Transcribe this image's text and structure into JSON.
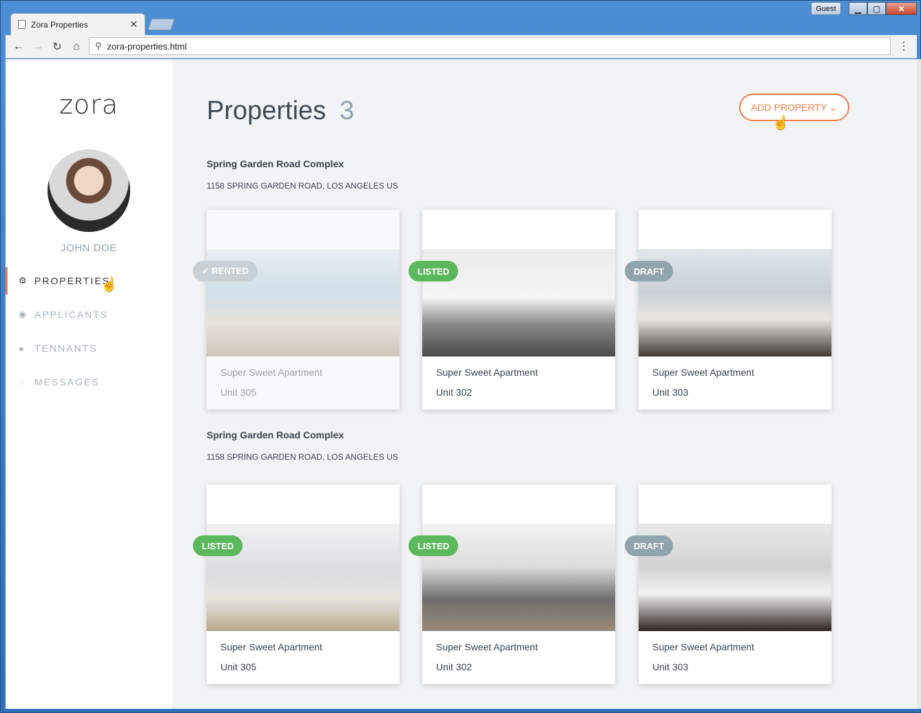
{
  "browser": {
    "tab_title": "Zora Properties",
    "guest_label": "Guest",
    "url": "zora-properties.html"
  },
  "sidebar": {
    "logo": "zora",
    "user_name": "JOHN DOE",
    "items": [
      {
        "label": "PROPERTIES",
        "icon": "gears-icon"
      },
      {
        "label": "APPLICANTS",
        "icon": "user-circle-icon"
      },
      {
        "label": "TENNANTS",
        "icon": "users-icon"
      },
      {
        "label": "MESSAGES",
        "icon": "chat-icon"
      }
    ]
  },
  "header": {
    "title": "Properties",
    "count": "3",
    "add_button": "ADD PROPERTY ⌄"
  },
  "groups": [
    {
      "title": "Spring Garden Road Complex",
      "address": "1158 SPRING GARDEN ROAD, LOS ANGELES US",
      "cards": [
        {
          "name": "Super Sweet Apartment",
          "unit": "Unit 305",
          "status": "✓ RENTED"
        },
        {
          "name": "Super Sweet Apartment",
          "unit": "Unit 302",
          "status": "LISTED"
        },
        {
          "name": "Super Sweet Apartment",
          "unit": "Unit 303",
          "status": "DRAFT"
        }
      ]
    },
    {
      "title": "Spring Garden Road Complex",
      "address": "1158 SPRING GARDEN ROAD, LOS ANGELES US",
      "cards": [
        {
          "name": "Super Sweet Apartment",
          "unit": "Unit 305",
          "status": "LISTED"
        },
        {
          "name": "Super Sweet Apartment",
          "unit": "Unit 302",
          "status": "LISTED"
        },
        {
          "name": "Super Sweet Apartment",
          "unit": "Unit 303",
          "status": "DRAFT"
        }
      ]
    }
  ],
  "colors": {
    "accent": "#f07c4a",
    "listed": "#5cb85c",
    "draft": "#90a4ae",
    "rented": "#c8d0d5"
  }
}
